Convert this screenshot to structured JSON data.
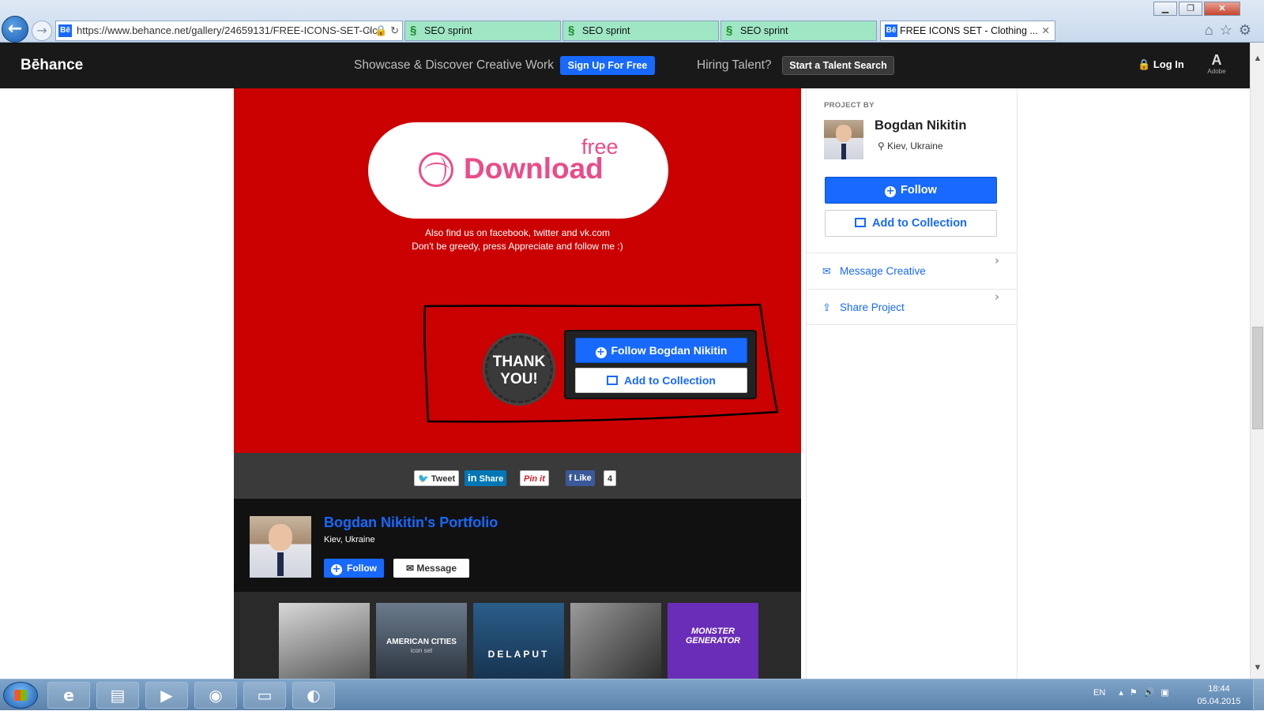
{
  "browser": {
    "url": "https://www.behance.net/gallery/24659131/FREE-ICONS-SET-Clc",
    "tabs": [
      {
        "label": "SEO sprint"
      },
      {
        "label": "SEO sprint"
      },
      {
        "label": "SEO sprint"
      },
      {
        "label": "FREE ICONS SET - Clothing ..."
      }
    ]
  },
  "header": {
    "logo": "Bēhance",
    "tagline": "Showcase & Discover Creative Work",
    "signup_label": "Sign Up For Free",
    "hiring": "Hiring Talent?",
    "talent_search_label": "Start a Talent Search",
    "login_label": "Log In",
    "adobe_label": "Adobe"
  },
  "project": {
    "free_label": "free",
    "download_label": "Download",
    "note_line1": "Also find us on facebook, twitter and vk.com",
    "note_line2": "Don't be greedy, press Appreciate and follow me :)",
    "thank_you_line1": "THANK",
    "thank_you_line2": "YOU!",
    "follow_owner_label": "Follow Bogdan Nikitin",
    "add_collection_label": "Add to Collection"
  },
  "share": {
    "tweet": "Tweet",
    "linkedin": "Share",
    "pinit": "Pin it",
    "like": "Like",
    "like_count": "4"
  },
  "portfolio": {
    "name": "Bogdan Nikitin's Portfolio",
    "location": "Kiev, Ukraine",
    "follow_label": "Follow",
    "message_label": "Message",
    "thumbnails": [
      {
        "label": ""
      },
      {
        "label": "AMERICAN CITIES",
        "sub": "icon set"
      },
      {
        "label": "DELAPUT"
      },
      {
        "label": ""
      },
      {
        "label": "MONSTER GENERATOR"
      }
    ]
  },
  "sidebar": {
    "project_by": "PROJECT BY",
    "owner_name": "Bogdan Nikitin",
    "owner_location": "Kiev, Ukraine",
    "follow_label": "Follow",
    "add_collection_label": "Add to Collection",
    "message_label": "Message Creative",
    "share_label": "Share Project"
  },
  "taskbar": {
    "language": "EN",
    "time": "18:44",
    "date": "05.04.2015"
  },
  "colors": {
    "behance_blue": "#1769ff",
    "project_red": "#cb0000",
    "dribbble_pink": "#ea4c89",
    "header_bg": "#191919"
  }
}
